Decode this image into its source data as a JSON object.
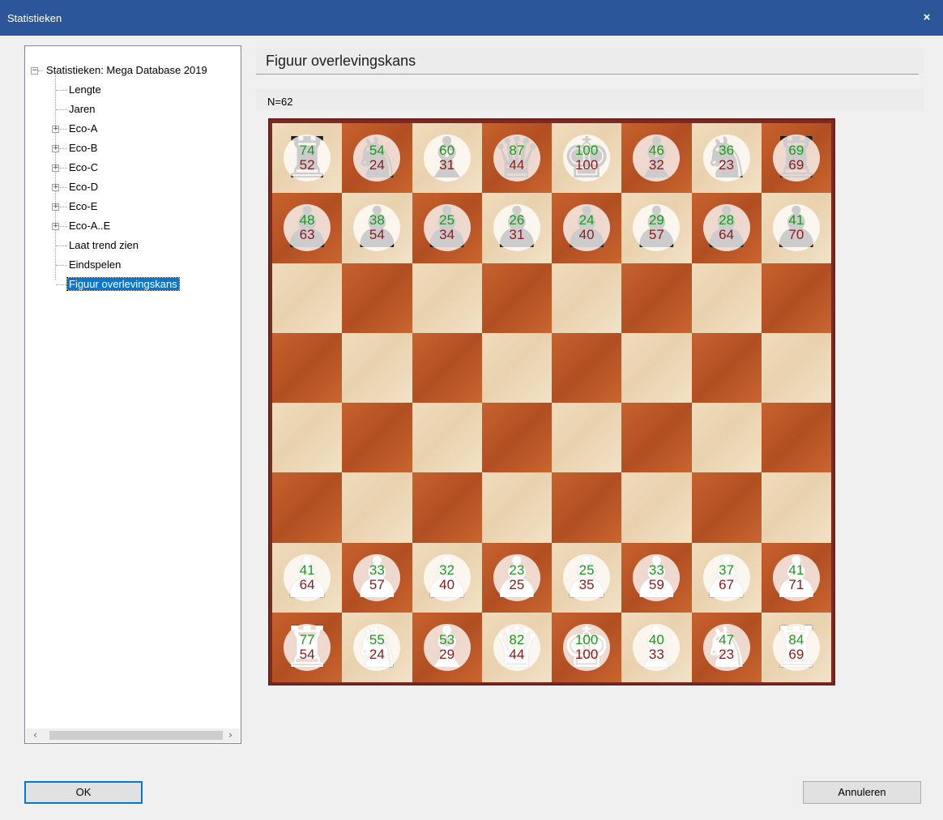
{
  "window": {
    "title": "Statistieken",
    "close_glyph": "×"
  },
  "tree": {
    "root": "Statistieken: Mega Database 2019",
    "items": [
      {
        "label": "Lengte",
        "expandable": false
      },
      {
        "label": "Jaren",
        "expandable": false
      },
      {
        "label": "Eco-A",
        "expandable": true
      },
      {
        "label": "Eco-B",
        "expandable": true
      },
      {
        "label": "Eco-C",
        "expandable": true
      },
      {
        "label": "Eco-D",
        "expandable": true
      },
      {
        "label": "Eco-E",
        "expandable": true
      },
      {
        "label": "Eco-A..E",
        "expandable": true
      },
      {
        "label": "Laat trend zien",
        "expandable": false
      },
      {
        "label": "Eindspelen",
        "expandable": false
      },
      {
        "label": "Figuur overlevingskans",
        "expandable": false,
        "selected": true
      }
    ]
  },
  "main": {
    "heading": "Figuur overlevingskans",
    "count": "N=62"
  },
  "board": {
    "ranks": [
      [
        {
          "piece": "black-rook",
          "green": "74",
          "red": "52"
        },
        {
          "piece": "black-knight",
          "green": "54",
          "red": "24"
        },
        {
          "piece": "black-bishop",
          "green": "60",
          "red": "31"
        },
        {
          "piece": "black-queen",
          "green": "87",
          "red": "44"
        },
        {
          "piece": "black-king",
          "green": "100",
          "red": "100"
        },
        {
          "piece": "black-bishop",
          "green": "46",
          "red": "32"
        },
        {
          "piece": "black-knight",
          "green": "36",
          "red": "23"
        },
        {
          "piece": "black-rook",
          "green": "69",
          "red": "69"
        }
      ],
      [
        {
          "piece": "black-pawn",
          "green": "48",
          "red": "63"
        },
        {
          "piece": "black-pawn",
          "green": "38",
          "red": "54"
        },
        {
          "piece": "black-pawn",
          "green": "25",
          "red": "34"
        },
        {
          "piece": "black-pawn",
          "green": "26",
          "red": "31"
        },
        {
          "piece": "black-pawn",
          "green": "24",
          "red": "40"
        },
        {
          "piece": "black-pawn",
          "green": "29",
          "red": "57"
        },
        {
          "piece": "black-pawn",
          "green": "28",
          "red": "64"
        },
        {
          "piece": "black-pawn",
          "green": "41",
          "red": "70"
        }
      ],
      [
        null,
        null,
        null,
        null,
        null,
        null,
        null,
        null
      ],
      [
        null,
        null,
        null,
        null,
        null,
        null,
        null,
        null
      ],
      [
        null,
        null,
        null,
        null,
        null,
        null,
        null,
        null
      ],
      [
        null,
        null,
        null,
        null,
        null,
        null,
        null,
        null
      ],
      [
        {
          "piece": "white-pawn",
          "green": "41",
          "red": "64"
        },
        {
          "piece": "white-pawn",
          "green": "33",
          "red": "57"
        },
        {
          "piece": "white-pawn",
          "green": "32",
          "red": "40"
        },
        {
          "piece": "white-pawn",
          "green": "23",
          "red": "25"
        },
        {
          "piece": "white-pawn",
          "green": "25",
          "red": "35"
        },
        {
          "piece": "white-pawn",
          "green": "33",
          "red": "59"
        },
        {
          "piece": "white-pawn",
          "green": "37",
          "red": "67"
        },
        {
          "piece": "white-pawn",
          "green": "41",
          "red": "71"
        }
      ],
      [
        {
          "piece": "white-rook",
          "green": "77",
          "red": "54"
        },
        {
          "piece": "white-knight",
          "green": "55",
          "red": "24"
        },
        {
          "piece": "white-bishop",
          "green": "53",
          "red": "29"
        },
        {
          "piece": "white-queen",
          "green": "82",
          "red": "44"
        },
        {
          "piece": "white-king",
          "green": "100",
          "red": "100"
        },
        {
          "piece": "white-bishop",
          "green": "40",
          "red": "33"
        },
        {
          "piece": "white-knight",
          "green": "47",
          "red": "23"
        },
        {
          "piece": "white-rook",
          "green": "84",
          "red": "69"
        }
      ]
    ]
  },
  "buttons": {
    "ok": "OK",
    "cancel": "Annuleren"
  },
  "colors": {
    "titlebar": "#2b579a",
    "green_value": "#1c9a1c",
    "red_value": "#8a1c1c",
    "selection": "#0078d7"
  }
}
